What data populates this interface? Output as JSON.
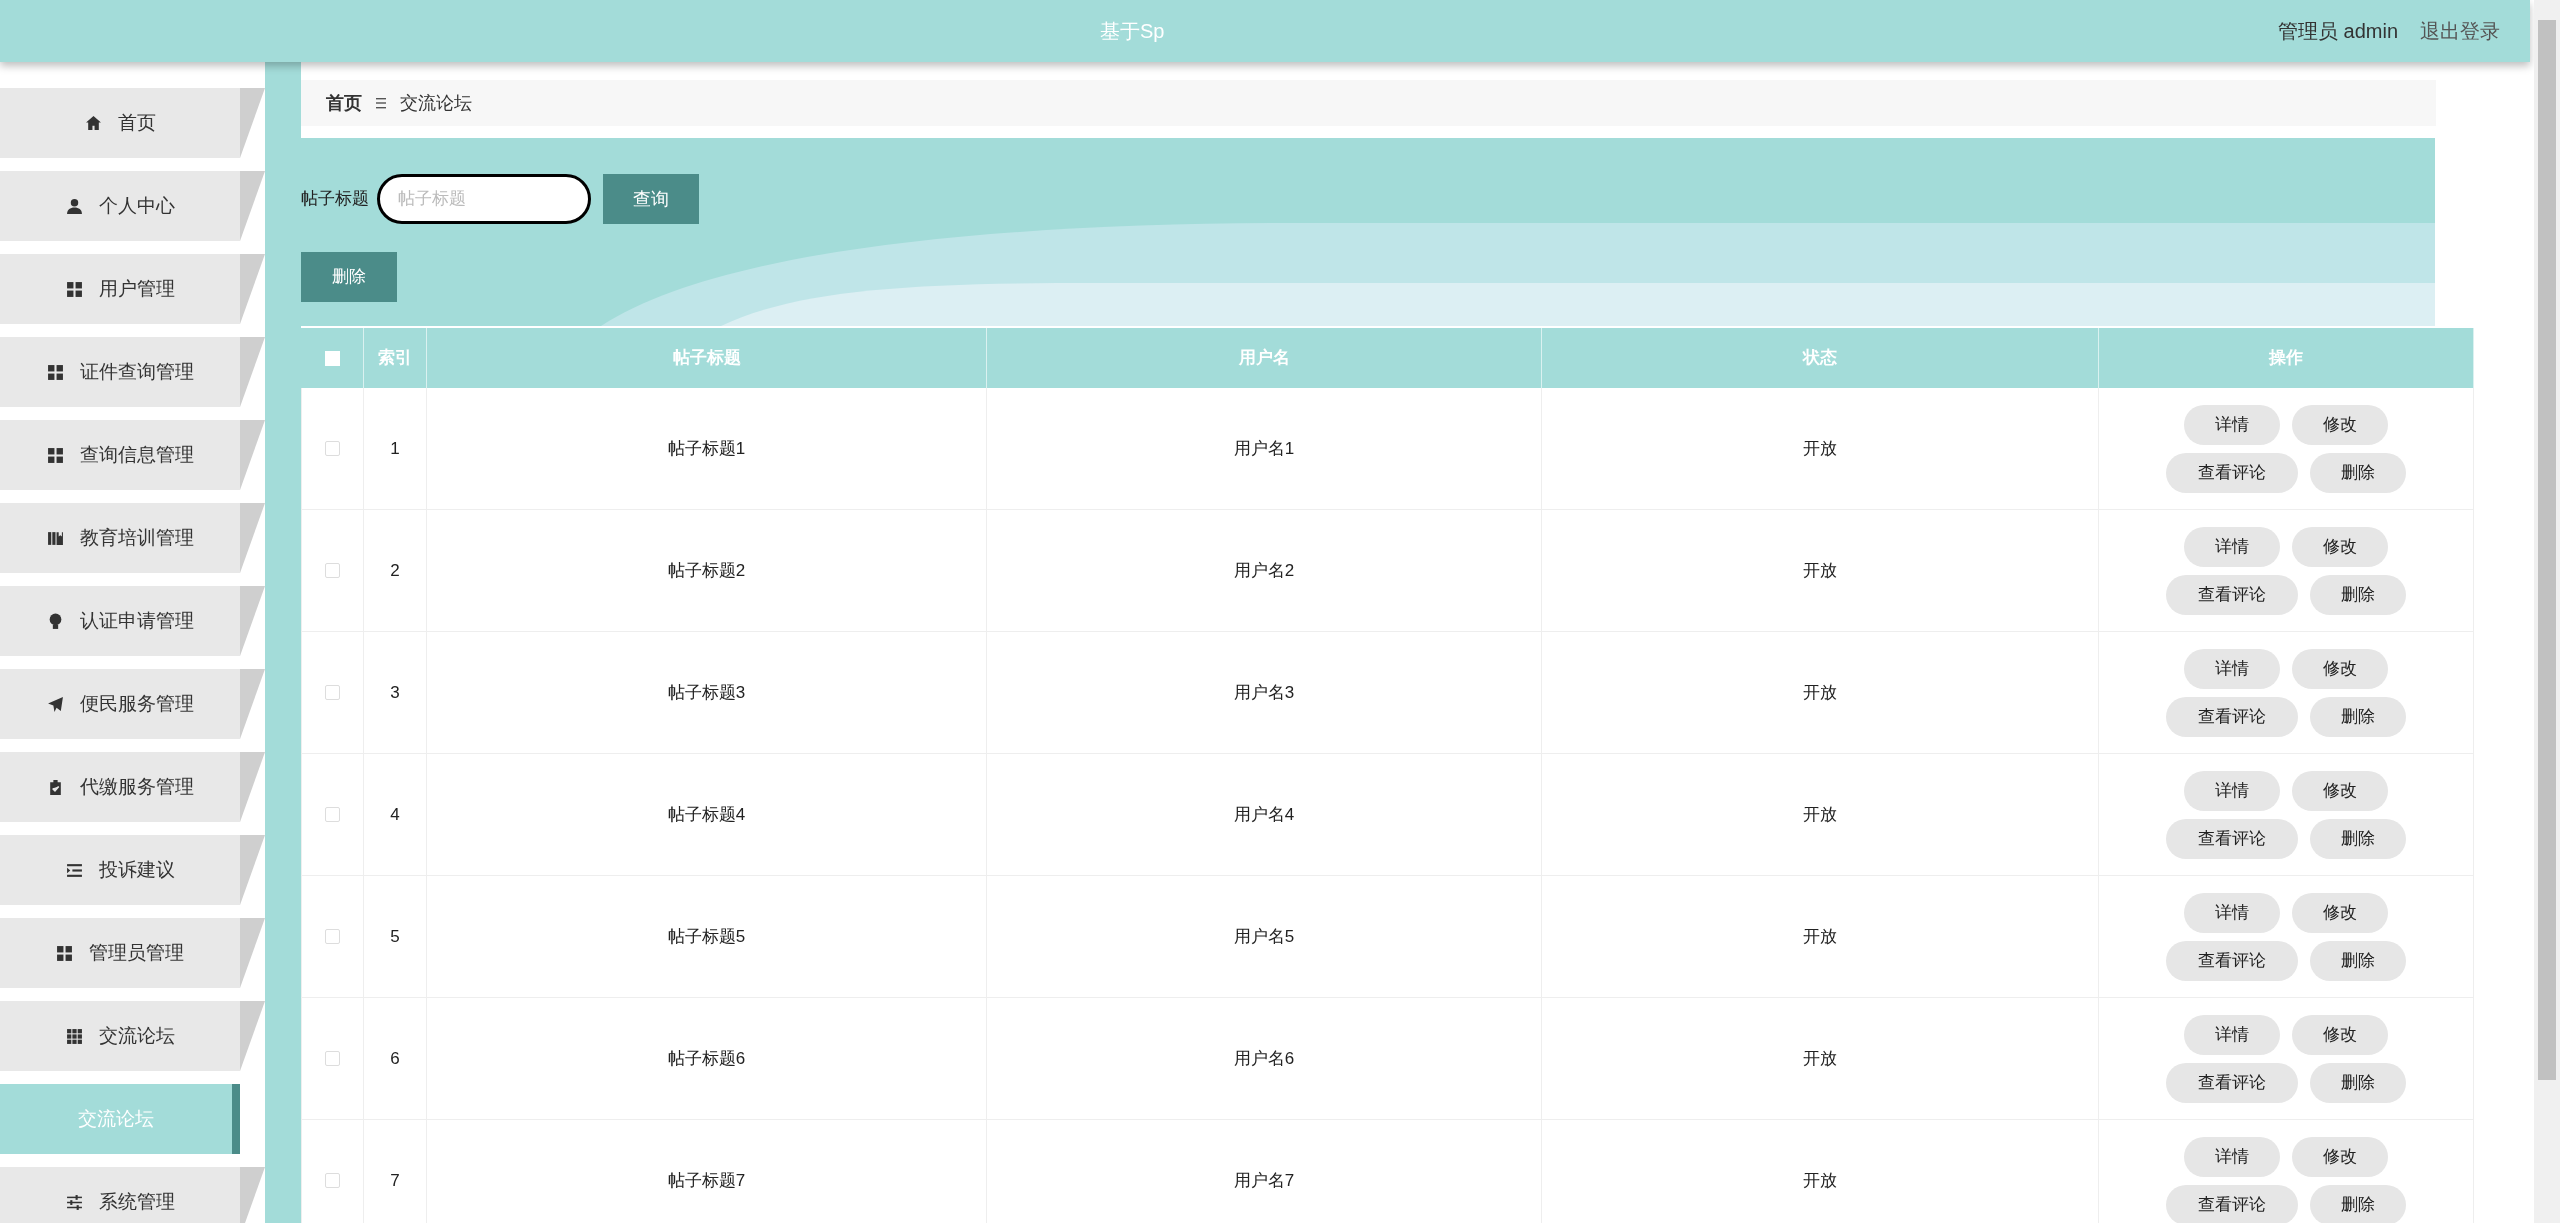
{
  "header": {
    "title": "基于Sp",
    "user": "管理员 admin",
    "logout": "退出登录"
  },
  "sidebar": {
    "items": [
      {
        "label": "首页",
        "selected": false
      },
      {
        "label": "个人中心",
        "selected": false
      },
      {
        "label": "用户管理",
        "selected": false
      },
      {
        "label": "证件查询管理",
        "selected": false
      },
      {
        "label": "查询信息管理",
        "selected": false
      },
      {
        "label": "教育培训管理",
        "selected": false
      },
      {
        "label": "认证申请管理",
        "selected": false
      },
      {
        "label": "便民服务管理",
        "selected": false
      },
      {
        "label": "代缴服务管理",
        "selected": false
      },
      {
        "label": "投诉建议",
        "selected": false
      },
      {
        "label": "管理员管理",
        "selected": false
      },
      {
        "label": "交流论坛",
        "selected": false,
        "children": [
          {
            "label": "交流论坛",
            "selected": true
          }
        ]
      },
      {
        "label": "系统管理",
        "selected": false
      }
    ]
  },
  "breadcrumb": [
    "首页",
    "交流论坛"
  ],
  "search": {
    "label": "帖子标题",
    "placeholder": "帖子标题",
    "button": "查询"
  },
  "delete_button": "删除",
  "table": {
    "all_checked": false,
    "columns": [
      "索引",
      "帖子标题",
      "用户名",
      "状态",
      "操作"
    ],
    "rows": [
      {
        "index": "1",
        "title": "帖子标题1",
        "user": "用户名1",
        "status": "开放",
        "checked": false,
        "actions": [
          "详情",
          "修改",
          "查看评论",
          "删除"
        ]
      },
      {
        "index": "2",
        "title": "帖子标题2",
        "user": "用户名2",
        "status": "开放",
        "checked": false,
        "actions": [
          "详情",
          "修改",
          "查看评论",
          "删除"
        ]
      },
      {
        "index": "3",
        "title": "帖子标题3",
        "user": "用户名3",
        "status": "开放",
        "checked": false,
        "actions": [
          "详情",
          "修改",
          "查看评论",
          "删除"
        ]
      },
      {
        "index": "4",
        "title": "帖子标题4",
        "user": "用户名4",
        "status": "开放",
        "checked": false,
        "actions": [
          "详情",
          "修改",
          "查看评论",
          "删除"
        ]
      },
      {
        "index": "5",
        "title": "帖子标题5",
        "user": "用户名5",
        "status": "开放",
        "checked": false,
        "actions": [
          "详情",
          "修改",
          "查看评论",
          "删除"
        ]
      },
      {
        "index": "6",
        "title": "帖子标题6",
        "user": "用户名6",
        "status": "开放",
        "checked": false,
        "actions": [
          "详情",
          "修改",
          "查看评论",
          "删除"
        ]
      },
      {
        "index": "7",
        "title": "帖子标题7",
        "user": "用户名7",
        "status": "开放",
        "checked": false,
        "actions": [
          "详情",
          "修改",
          "查看评论",
          "删除"
        ]
      }
    ]
  }
}
